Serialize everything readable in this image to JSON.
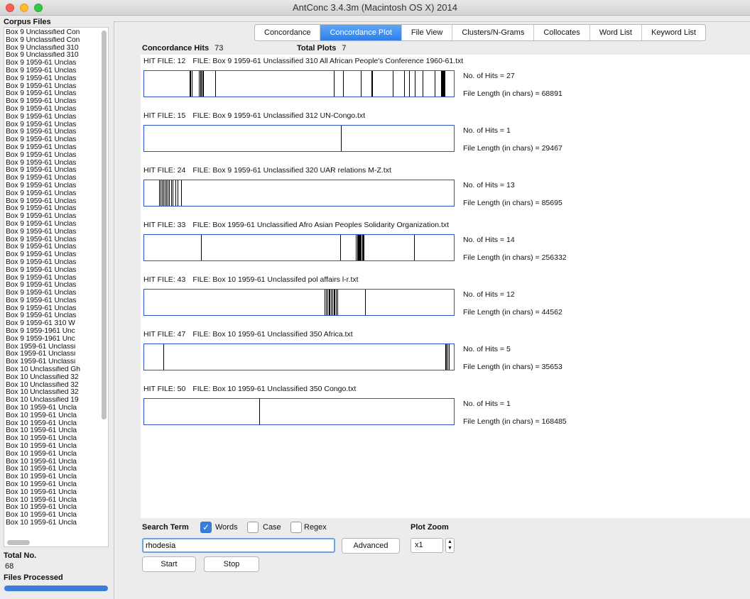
{
  "window": {
    "title": "AntConc 3.4.3m (Macintosh OS X) 2014"
  },
  "sidebar": {
    "corpus_title": "Corpus Files",
    "files": [
      "Box 9 Unclassified Con",
      "Box 9 Unclassified Con",
      "Box 9 Unclassified 310",
      "Box 9 Unclassified 310",
      "Box 9 1959-61 Unclas",
      "Box 9 1959-61 Unclas",
      "Box 9 1959-61 Unclas",
      "Box 9 1959-61 Unclas",
      "Box 9 1959-61 Unclas",
      "Box 9 1959-61 Unclas",
      "Box 9 1959-61 Unclas",
      "Box 9 1959-61 Unclas",
      "Box 9 1959-61 Unclas",
      "Box 9 1959-61 Unclas",
      "Box 9 1959-61 Unclas",
      "Box 9 1959-61 Unclas",
      "Box 9 1959-61 Unclas",
      "Box 9 1959-61 Unclas",
      "Box 9 1959-61 Unclas",
      "Box 9 1959-61 Unclas",
      "Box 9 1959-61 Unclas",
      "Box 9 1959-61 Unclas",
      "Box 9 1959-61 Unclas",
      "Box 9 1959-61 Unclas",
      "Box 9 1959-61 Unclas",
      "Box 9 1959-61 Unclas",
      "Box 9 1959-61 Unclas",
      "Box 9 1959-61 Unclas",
      "Box 9 1959-61 Unclas",
      "Box 9 1959-61 Unclas",
      "Box 9 1959-61 Unclas",
      "Box 9 1959-61 Unclas",
      "Box 9 1959-61 Unclas",
      "Box 9 1959-61 Unclas",
      "Box 9 1959-61 Unclas",
      "Box 9 1959-61 Unclas",
      "Box 9 1959-61 Unclas",
      "Box 9 1959-61 Unclas",
      "Box 9 1959-61 310 W",
      "Box 9 1959-1961 Unc",
      "Box 9 1959-1961 Unc",
      "Box 1959-61 Unclassi",
      "Box 1959-61 Unclassi",
      "Box 1959-61 Unclassi",
      "Box 10 Unclassified Gh",
      "Box 10 Unclassified 32",
      "Box 10 Unclassified 32",
      "Box 10 Unclassified 32",
      "Box 10 Unclassified 19",
      "Box 10 1959-61 Uncla",
      "Box 10 1959-61 Uncla",
      "Box 10 1959-61 Uncla",
      "Box 10 1959-61 Uncla",
      "Box 10 1959-61 Uncla",
      "Box 10 1959-61 Uncla",
      "Box 10 1959-61 Uncla",
      "Box 10 1959-61 Uncla",
      "Box 10 1959-61 Uncla",
      "Box 10 1959-61 Uncla",
      "Box 10 1959-61 Uncla",
      "Box 10 1959-61 Uncla",
      "Box 10 1959-61 Uncla",
      "Box 10 1959-61 Uncla",
      "Box 10 1959-61 Uncla",
      "Box 10 1959-61 Uncla"
    ],
    "total_label": "Total No.",
    "total_value": "68",
    "processed_label": "Files Processed",
    "processed_fraction": 1.0
  },
  "tabs": [
    {
      "label": "Concordance",
      "active": false
    },
    {
      "label": "Concordance Plot",
      "active": true
    },
    {
      "label": "File View",
      "active": false
    },
    {
      "label": "Clusters/N-Grams",
      "active": false
    },
    {
      "label": "Collocates",
      "active": false
    },
    {
      "label": "Word List",
      "active": false
    },
    {
      "label": "Keyword List",
      "active": false
    }
  ],
  "stats": {
    "hits_label": "Concordance Hits",
    "hits_value": "73",
    "plots_label": "Total Plots",
    "plots_value": "7"
  },
  "plots": [
    {
      "hit_file": "HIT FILE: 12",
      "file": "FILE: Box 9 1959-61 Unclassified 310 All African People's Conference 1960-61.txt",
      "hits_text": "No. of Hits = 27",
      "length_text": "File Length (in chars) = 68891",
      "positions": [
        0.145,
        0.148,
        0.152,
        0.175,
        0.179,
        0.182,
        0.186,
        0.19,
        0.227,
        0.614,
        0.644,
        0.7,
        0.735,
        0.738,
        0.804,
        0.84,
        0.856,
        0.876,
        0.9,
        0.94,
        0.96,
        0.962,
        0.964,
        0.966,
        0.968,
        0.97,
        0.972
      ]
    },
    {
      "hit_file": "HIT FILE: 15",
      "file": "FILE: Box 9 1959-61 Unclassified 312 UN-Congo.txt",
      "hits_text": "No. of Hits = 1",
      "length_text": "File Length (in chars) = 29467",
      "positions": [
        0.637
      ]
    },
    {
      "hit_file": "HIT FILE: 24",
      "file": "FILE: Box 9 1959-61 Unclassified 320 UAR relations M-Z.txt",
      "hits_text": "No. of Hits = 13",
      "length_text": "File Length (in chars) = 85695",
      "positions": [
        0.045,
        0.05,
        0.055,
        0.06,
        0.065,
        0.07,
        0.074,
        0.078,
        0.085,
        0.09,
        0.1,
        0.106,
        0.118
      ]
    },
    {
      "hit_file": "HIT FILE: 33",
      "file": "FILE: Box 1959-61 Unclassified Afro Asian Peoples Solidarity Organization.txt",
      "hits_text": "No. of Hits = 14",
      "length_text": "File Length (in chars) = 256332",
      "positions": [
        0.183,
        0.633,
        0.684,
        0.688,
        0.69,
        0.692,
        0.694,
        0.696,
        0.698,
        0.701,
        0.704,
        0.707,
        0.71,
        0.874
      ]
    },
    {
      "hit_file": "HIT FILE: 43",
      "file": "FILE: Box 10 1959-61 Unclassifed pol affairs l-r.txt",
      "hits_text": "No. of Hits = 12",
      "length_text": "File Length (in chars) = 44562",
      "positions": [
        0.584,
        0.588,
        0.592,
        0.596,
        0.6,
        0.604,
        0.608,
        0.612,
        0.616,
        0.62,
        0.624,
        0.714
      ]
    },
    {
      "hit_file": "HIT FILE: 47",
      "file": "FILE: Box 10 1959-61 Unclassified 350 Africa.txt",
      "hits_text": "No. of Hits = 5",
      "length_text": "File Length (in chars) = 35653",
      "positions": [
        0.06,
        0.974,
        0.978,
        0.982,
        0.986
      ]
    },
    {
      "hit_file": "HIT FILE: 50",
      "file": "FILE: Box 10 1959-61 Unclassified 350 Congo.txt",
      "hits_text": "No. of Hits = 1",
      "length_text": "File Length (in chars) = 168485",
      "positions": [
        0.37
      ]
    }
  ],
  "search": {
    "label": "Search Term",
    "words_label": "Words",
    "words_checked": true,
    "case_label": "Case",
    "case_checked": false,
    "regex_label": "Regex",
    "regex_checked": false,
    "value": "rhodesia",
    "advanced_label": "Advanced",
    "start_label": "Start",
    "stop_label": "Stop",
    "zoom_label": "Plot Zoom",
    "zoom_value": "x1"
  },
  "colors": {
    "plot_border": "#2c52c8",
    "active_tab": "#2f7ee9",
    "progress": "#3b7ddd"
  }
}
